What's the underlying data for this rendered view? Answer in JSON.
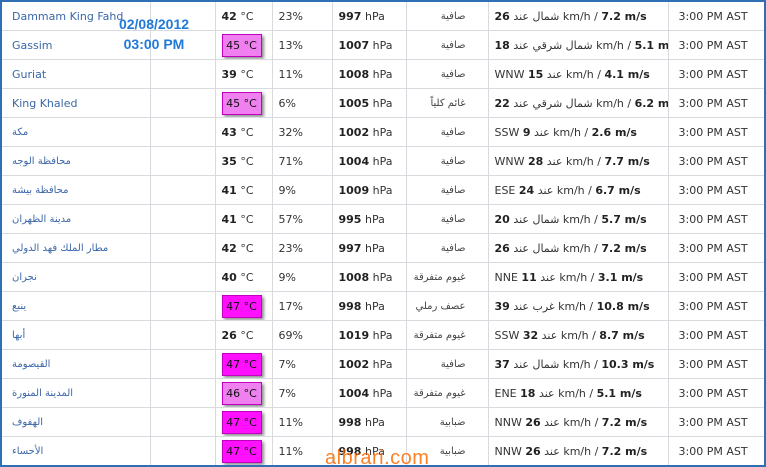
{
  "overlay": {
    "date": "02/08/2012",
    "time": "03:00 PM"
  },
  "watermark": "albrari.com",
  "unit_temp": "°C",
  "unit_press": "hPa",
  "colors": {
    "heat_light": "#f080f0",
    "heat_strong": "#ff10ff",
    "link": "#3a66a8",
    "frame": "#2f6fb3"
  },
  "rows": [
    {
      "city": "Dammam King Fahd",
      "temp": "42",
      "heat": "",
      "humidity": "23%",
      "pressure": "997",
      "condition": "صافية",
      "wind_speed": "26",
      "wind_text": "شمال عند km/h /",
      "wind_ms": "7.2 m/s",
      "time": "3:00 PM AST"
    },
    {
      "city": "Gassim",
      "temp": "45",
      "heat": "light",
      "humidity": "13%",
      "pressure": "1007",
      "condition": "صافية",
      "wind_speed": "18",
      "wind_text": "شمال شرقي عند km/h /",
      "wind_ms": "5.1 m/s",
      "time": "3:00 PM AST"
    },
    {
      "city": "Guriat",
      "temp": "39",
      "heat": "",
      "humidity": "11%",
      "pressure": "1008",
      "condition": "صافية",
      "wind_prefix": "WNW",
      "wind_speed": "15",
      "wind_text": "عند km/h /",
      "wind_ms": "4.1 m/s",
      "time": "3:00 PM AST"
    },
    {
      "city": "King Khaled",
      "temp": "45",
      "heat": "light",
      "humidity": "6%",
      "pressure": "1005",
      "condition": "غائم كلياً",
      "wind_speed": "22",
      "wind_text": "شمال شرقي عند km/h /",
      "wind_ms": "6.2 m/s",
      "time": "3:00 PM AST"
    },
    {
      "city": "مكة",
      "temp": "43",
      "heat": "",
      "humidity": "32%",
      "pressure": "1002",
      "condition": "صافية",
      "wind_prefix": "SSW",
      "wind_speed": "9",
      "wind_text": "عند km/h /",
      "wind_ms": "2.6 m/s",
      "time": "3:00 PM AST"
    },
    {
      "city": "محافظة الوجه",
      "temp": "35",
      "heat": "",
      "humidity": "71%",
      "pressure": "1004",
      "condition": "صافية",
      "wind_prefix": "WNW",
      "wind_speed": "28",
      "wind_text": "عند km/h /",
      "wind_ms": "7.7 m/s",
      "time": "3:00 PM AST"
    },
    {
      "city": "محافظة بيشة",
      "temp": "41",
      "heat": "",
      "humidity": "9%",
      "pressure": "1009",
      "condition": "صافية",
      "wind_prefix": "ESE",
      "wind_speed": "24",
      "wind_text": "عند km/h /",
      "wind_ms": "6.7 m/s",
      "time": "3:00 PM AST"
    },
    {
      "city": "مدينة الظهران",
      "temp": "41",
      "heat": "",
      "humidity": "57%",
      "pressure": "995",
      "condition": "صافية",
      "wind_speed": "20",
      "wind_text": "شمال عند km/h /",
      "wind_ms": "5.7 m/s",
      "time": "3:00 PM AST"
    },
    {
      "city": "مطار الملك فهد الدولي",
      "temp": "42",
      "heat": "",
      "humidity": "23%",
      "pressure": "997",
      "condition": "صافية",
      "wind_speed": "26",
      "wind_text": "شمال عند km/h /",
      "wind_ms": "7.2 m/s",
      "time": "3:00 PM AST"
    },
    {
      "city": "نجران",
      "temp": "40",
      "heat": "",
      "humidity": "9%",
      "pressure": "1008",
      "condition": "غيوم متفرقة",
      "wind_prefix": "NNE",
      "wind_speed": "11",
      "wind_text": "عند km/h /",
      "wind_ms": "3.1 m/s",
      "time": "3:00 PM AST"
    },
    {
      "city": "ينبع",
      "temp": "47",
      "heat": "strong",
      "humidity": "17%",
      "pressure": "998",
      "condition": "عصف رملي",
      "wind_speed": "39",
      "wind_text": "غرب عند km/h /",
      "wind_ms": "10.8 m/s",
      "time": "3:00 PM AST"
    },
    {
      "city": "أبها",
      "temp": "26",
      "heat": "",
      "humidity": "69%",
      "pressure": "1019",
      "condition": "غيوم متفرقة",
      "wind_prefix": "SSW",
      "wind_speed": "32",
      "wind_text": "عند km/h /",
      "wind_ms": "8.7 m/s",
      "time": "3:00 PM AST"
    },
    {
      "city": "القيصومة",
      "temp": "47",
      "heat": "strong",
      "humidity": "7%",
      "pressure": "1002",
      "condition": "صافية",
      "wind_speed": "37",
      "wind_text": "شمال عند km/h /",
      "wind_ms": "10.3 m/s",
      "time": "3:00 PM AST"
    },
    {
      "city": "المدينة المنورة",
      "temp": "46",
      "heat": "light",
      "humidity": "7%",
      "pressure": "1004",
      "condition": "غيوم متفرقة",
      "wind_prefix": "ENE",
      "wind_speed": "18",
      "wind_text": "عند km/h /",
      "wind_ms": "5.1 m/s",
      "time": "3:00 PM AST"
    },
    {
      "city": "الهفوف",
      "temp": "47",
      "heat": "strong",
      "humidity": "11%",
      "pressure": "998",
      "condition": "ضبابية",
      "wind_prefix": "NNW",
      "wind_speed": "26",
      "wind_text": "عند km/h /",
      "wind_ms": "7.2 m/s",
      "time": "3:00 PM AST"
    },
    {
      "city": "الأحساء",
      "temp": "47",
      "heat": "strong",
      "humidity": "11%",
      "pressure": "998",
      "condition": "ضبابية",
      "wind_prefix": "NNW",
      "wind_speed": "26",
      "wind_text": "عند km/h /",
      "wind_ms": "7.2 m/s",
      "time": "3:00 PM AST"
    }
  ]
}
